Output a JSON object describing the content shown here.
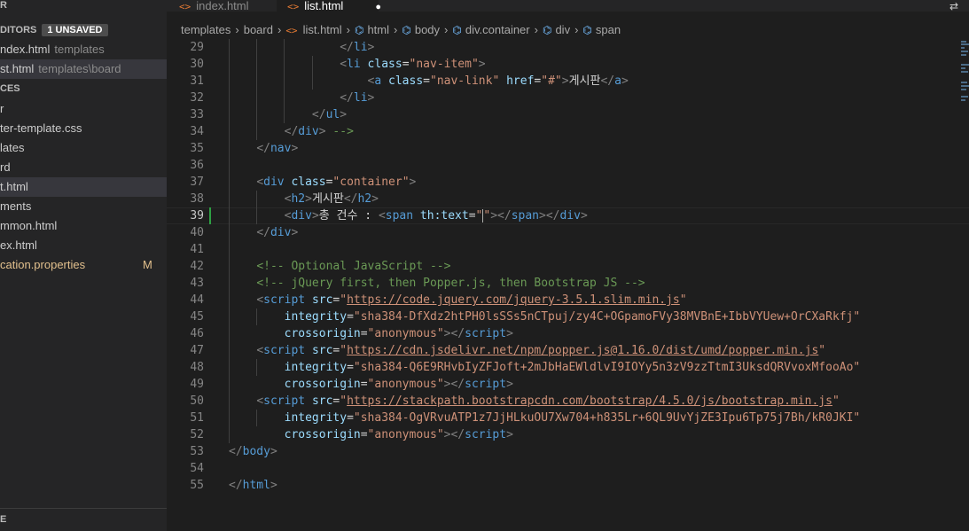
{
  "sidebar": {
    "explorer_label": "R",
    "open_editors_label": "DITORS",
    "unsaved_badge": "1 UNSAVED",
    "open_editors": [
      {
        "name": "ndex.html",
        "desc": "templates"
      },
      {
        "name": "st.html",
        "desc": "templates\\board"
      }
    ],
    "resources_label": "CES",
    "tree": [
      {
        "name": "r"
      },
      {
        "name": "ter-template.css"
      },
      {
        "name": "lates"
      },
      {
        "name": "rd"
      },
      {
        "name": "t.html"
      },
      {
        "name": "ments"
      },
      {
        "name": "mmon.html"
      },
      {
        "name": "ex.html"
      },
      {
        "name": "cation.properties",
        "badge": "M"
      }
    ],
    "bottom_label": "E"
  },
  "tabs": [
    {
      "label": "index.html",
      "icon": "<>"
    },
    {
      "label": "list.html",
      "icon": "<>",
      "dirty": "●"
    }
  ],
  "breadcrumb": {
    "items": [
      "templates",
      "board",
      "list.html",
      "html",
      "body",
      "div.container",
      "div",
      "span"
    ],
    "icons": [
      "",
      "",
      "<>",
      "⌬",
      "⌬",
      "⌬",
      "⌬",
      "⌬"
    ],
    "separator": "›"
  },
  "editor": {
    "current_line": "39",
    "lines": [
      {
        "n": "29",
        "indent": "            ",
        "tokens": [
          [
            "p",
            "</"
          ],
          [
            "t",
            "li"
          ],
          [
            "p",
            ">"
          ]
        ]
      },
      {
        "n": "30",
        "indent": "            ",
        "tokens": [
          [
            "p",
            "<"
          ],
          [
            "t",
            "li"
          ],
          [
            "x",
            " "
          ],
          [
            "a",
            "class"
          ],
          [
            "x",
            "="
          ],
          [
            "s",
            "\"nav-item\""
          ],
          [
            "p",
            ">"
          ]
        ]
      },
      {
        "n": "31",
        "indent": "                ",
        "tokens": [
          [
            "p",
            "<"
          ],
          [
            "t",
            "a"
          ],
          [
            "x",
            " "
          ],
          [
            "a",
            "class"
          ],
          [
            "x",
            "="
          ],
          [
            "s",
            "\"nav-link\""
          ],
          [
            "x",
            " "
          ],
          [
            "a",
            "href"
          ],
          [
            "x",
            "="
          ],
          [
            "s",
            "\"#\""
          ],
          [
            "p",
            ">"
          ],
          [
            "x",
            "게시판"
          ],
          [
            "p",
            "</"
          ],
          [
            "t",
            "a"
          ],
          [
            "p",
            ">"
          ]
        ]
      },
      {
        "n": "32",
        "indent": "            ",
        "tokens": [
          [
            "p",
            "</"
          ],
          [
            "t",
            "li"
          ],
          [
            "p",
            ">"
          ]
        ]
      },
      {
        "n": "33",
        "indent": "        ",
        "tokens": [
          [
            "p",
            "</"
          ],
          [
            "t",
            "ul"
          ],
          [
            "p",
            ">"
          ]
        ]
      },
      {
        "n": "34",
        "indent": "    ",
        "tokens": [
          [
            "p",
            "</"
          ],
          [
            "t",
            "div"
          ],
          [
            "p",
            "> "
          ],
          [
            "c",
            "-->"
          ]
        ]
      },
      {
        "n": "35",
        "indent": "",
        "tokens": [
          [
            "p",
            "</"
          ],
          [
            "t",
            "nav"
          ],
          [
            "p",
            ">"
          ]
        ]
      },
      {
        "n": "36",
        "indent": "",
        "tokens": []
      },
      {
        "n": "37",
        "indent": "",
        "tokens": [
          [
            "p",
            "<"
          ],
          [
            "t",
            "div"
          ],
          [
            "x",
            " "
          ],
          [
            "a",
            "class"
          ],
          [
            "x",
            "="
          ],
          [
            "s",
            "\"container\""
          ],
          [
            "p",
            ">"
          ]
        ]
      },
      {
        "n": "38",
        "indent": "    ",
        "tokens": [
          [
            "p",
            "<"
          ],
          [
            "t",
            "h2"
          ],
          [
            "p",
            ">"
          ],
          [
            "x",
            "게시판"
          ],
          [
            "p",
            "</"
          ],
          [
            "t",
            "h2"
          ],
          [
            "p",
            ">"
          ]
        ]
      },
      {
        "n": "39",
        "indent": "    ",
        "tokens": [
          [
            "p",
            "<"
          ],
          [
            "t",
            "div"
          ],
          [
            "p",
            ">"
          ],
          [
            "x",
            "총 건수 : "
          ],
          [
            "p",
            "<"
          ],
          [
            "t",
            "span"
          ],
          [
            "x",
            " "
          ],
          [
            "a",
            "th:text"
          ],
          [
            "x",
            "="
          ],
          [
            "s",
            "\""
          ],
          [
            "cur",
            ""
          ],
          [
            "s",
            "\""
          ],
          [
            "p",
            ">"
          ],
          [
            "p",
            "</"
          ],
          [
            "t",
            "span"
          ],
          [
            "p",
            "></"
          ],
          [
            "t",
            "div"
          ],
          [
            "p",
            ">"
          ]
        ]
      },
      {
        "n": "40",
        "indent": "",
        "tokens": [
          [
            "p",
            "</"
          ],
          [
            "t",
            "div"
          ],
          [
            "p",
            ">"
          ]
        ]
      },
      {
        "n": "41",
        "indent": "",
        "tokens": []
      },
      {
        "n": "42",
        "indent": "",
        "tokens": [
          [
            "c",
            "<!-- Optional JavaScript -->"
          ]
        ]
      },
      {
        "n": "43",
        "indent": "",
        "tokens": [
          [
            "c",
            "<!-- jQuery first, then Popper.js, then Bootstrap JS -->"
          ]
        ]
      },
      {
        "n": "44",
        "indent": "",
        "tokens": [
          [
            "p",
            "<"
          ],
          [
            "t",
            "script"
          ],
          [
            "x",
            " "
          ],
          [
            "a",
            "src"
          ],
          [
            "x",
            "="
          ],
          [
            "s",
            "\""
          ],
          [
            "u",
            "https://code.jquery.com/jquery-3.5.1.slim.min.js"
          ],
          [
            "s",
            "\""
          ]
        ]
      },
      {
        "n": "45",
        "indent": "    ",
        "tokens": [
          [
            "a",
            "integrity"
          ],
          [
            "x",
            "="
          ],
          [
            "s",
            "\"sha384-DfXdz2htPH0lsSSs5nCTpuj/zy4C+OGpamoFVy38MVBnE+IbbVYUew+OrCXaRkfj\""
          ]
        ]
      },
      {
        "n": "46",
        "indent": "    ",
        "tokens": [
          [
            "a",
            "crossorigin"
          ],
          [
            "x",
            "="
          ],
          [
            "s",
            "\"anonymous\""
          ],
          [
            "p",
            "></"
          ],
          [
            "t",
            "script"
          ],
          [
            "p",
            ">"
          ]
        ]
      },
      {
        "n": "47",
        "indent": "",
        "tokens": [
          [
            "p",
            "<"
          ],
          [
            "t",
            "script"
          ],
          [
            "x",
            " "
          ],
          [
            "a",
            "src"
          ],
          [
            "x",
            "="
          ],
          [
            "s",
            "\""
          ],
          [
            "u",
            "https://cdn.jsdelivr.net/npm/popper.js@1.16.0/dist/umd/popper.min.js"
          ],
          [
            "s",
            "\""
          ]
        ]
      },
      {
        "n": "48",
        "indent": "    ",
        "tokens": [
          [
            "a",
            "integrity"
          ],
          [
            "x",
            "="
          ],
          [
            "s",
            "\"sha384-Q6E9RHvbIyZFJoft+2mJbHaEWldlvI9IOYy5n3zV9zzTtmI3UksdQRVvoxMfooAo\""
          ]
        ]
      },
      {
        "n": "49",
        "indent": "    ",
        "tokens": [
          [
            "a",
            "crossorigin"
          ],
          [
            "x",
            "="
          ],
          [
            "s",
            "\"anonymous\""
          ],
          [
            "p",
            "></"
          ],
          [
            "t",
            "script"
          ],
          [
            "p",
            ">"
          ]
        ]
      },
      {
        "n": "50",
        "indent": "",
        "tokens": [
          [
            "p",
            "<"
          ],
          [
            "t",
            "script"
          ],
          [
            "x",
            " "
          ],
          [
            "a",
            "src"
          ],
          [
            "x",
            "="
          ],
          [
            "s",
            "\""
          ],
          [
            "u",
            "https://stackpath.bootstrapcdn.com/bootstrap/4.5.0/js/bootstrap.min.js"
          ],
          [
            "s",
            "\""
          ]
        ]
      },
      {
        "n": "51",
        "indent": "    ",
        "tokens": [
          [
            "a",
            "integrity"
          ],
          [
            "x",
            "="
          ],
          [
            "s",
            "\"sha384-OgVRvuATP1z7JjHLkuOU7Xw704+h835Lr+6QL9UvYjZE3Ipu6Tp75j7Bh/kR0JKI\""
          ]
        ]
      },
      {
        "n": "52",
        "indent": "    ",
        "tokens": [
          [
            "a",
            "crossorigin"
          ],
          [
            "x",
            "="
          ],
          [
            "s",
            "\"anonymous\""
          ],
          [
            "p",
            "></"
          ],
          [
            "t",
            "script"
          ],
          [
            "p",
            ">"
          ]
        ]
      },
      {
        "n": "53",
        "indent": "",
        "tokens": [
          [
            "p",
            "</"
          ],
          [
            "t",
            "body"
          ],
          [
            "p",
            ">"
          ]
        ],
        "outdent": true
      },
      {
        "n": "54",
        "indent": "",
        "tokens": []
      },
      {
        "n": "55",
        "indent": "",
        "tokens": [
          [
            "p",
            "</"
          ],
          [
            "t",
            "html"
          ],
          [
            "p",
            ">"
          ]
        ],
        "outdent": true
      }
    ]
  },
  "top_right_icon": "⇄",
  "colors": {
    "tag": "#569cd6",
    "attribute": "#9cdcfe",
    "string": "#ce9178",
    "comment": "#6a9955",
    "html_icon": "#e37933",
    "modified": "#e2c08d"
  }
}
